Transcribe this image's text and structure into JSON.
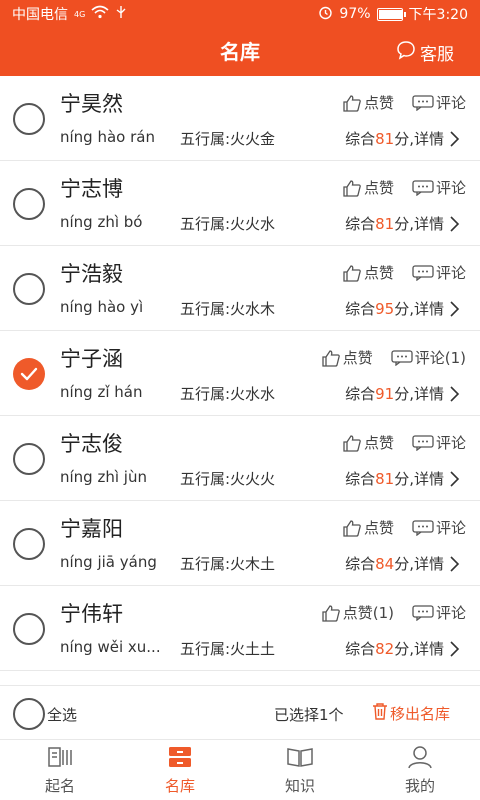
{
  "status_bar": {
    "carrier": "中国电信",
    "network": "4G",
    "battery": "97%",
    "battery_level": 0.97,
    "time": "下午3:20"
  },
  "header": {
    "title": "名库",
    "service_label": "客服"
  },
  "list": [
    {
      "name": "宁昊然",
      "pinyin": "níng hào rán",
      "wuxing": "五行属:火火金",
      "score_prefix": "综合",
      "score": "81",
      "score_suffix": "分,详情",
      "like": "点赞",
      "comment": "评论",
      "checked": false
    },
    {
      "name": "宁志博",
      "pinyin": "níng zhì bó",
      "wuxing": "五行属:火火水",
      "score_prefix": "综合",
      "score": "81",
      "score_suffix": "分,详情",
      "like": "点赞",
      "comment": "评论",
      "checked": false
    },
    {
      "name": "宁浩毅",
      "pinyin": "níng hào yì",
      "wuxing": "五行属:火水木",
      "score_prefix": "综合",
      "score": "95",
      "score_suffix": "分,详情",
      "like": "点赞",
      "comment": "评论",
      "checked": false
    },
    {
      "name": "宁子涵",
      "pinyin": "níng zǐ hán",
      "wuxing": "五行属:火水水",
      "score_prefix": "综合",
      "score": "91",
      "score_suffix": "分,详情",
      "like": "点赞",
      "comment": "评论(1)",
      "checked": true
    },
    {
      "name": "宁志俊",
      "pinyin": "níng zhì jùn",
      "wuxing": "五行属:火火火",
      "score_prefix": "综合",
      "score": "81",
      "score_suffix": "分,详情",
      "like": "点赞",
      "comment": "评论",
      "checked": false
    },
    {
      "name": "宁嘉阳",
      "pinyin": "níng jiā yáng",
      "wuxing": "五行属:火木土",
      "score_prefix": "综合",
      "score": "84",
      "score_suffix": "分,详情",
      "like": "点赞",
      "comment": "评论",
      "checked": false
    },
    {
      "name": "宁伟轩",
      "pinyin": "níng wěi xu...",
      "wuxing": "五行属:火土土",
      "score_prefix": "综合",
      "score": "82",
      "score_suffix": "分,详情",
      "like": "点赞(1)",
      "comment": "评论",
      "checked": false
    }
  ],
  "action_bar": {
    "select_all": "全选",
    "selected_count": "已选择1个",
    "remove": "移出名库"
  },
  "tabs": [
    {
      "label": "起名",
      "icon": "book-icon"
    },
    {
      "label": "名库",
      "icon": "drawer-icon"
    },
    {
      "label": "知识",
      "icon": "open-book-icon"
    },
    {
      "label": "我的",
      "icon": "person-icon"
    }
  ],
  "colors": {
    "accent": "#ef4f22",
    "score": "#ef5a2a"
  }
}
